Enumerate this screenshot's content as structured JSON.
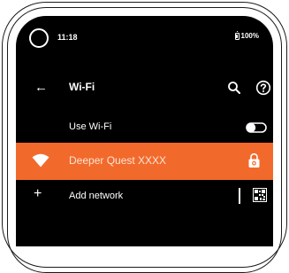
{
  "status_bar": {
    "time": "11:18",
    "battery": "100%"
  },
  "toolbar": {
    "title": "Wi-Fi",
    "back_icon": "←"
  },
  "use_wifi": {
    "label": "Use Wi-Fi",
    "enabled": false
  },
  "network": {
    "ssid": "Deeper Quest XXXX",
    "secured": true
  },
  "add_network": {
    "label": "Add network",
    "plus_icon": "+"
  },
  "colors": {
    "accent": "#f26a2b",
    "background": "#000000",
    "text": "#ffffff"
  }
}
